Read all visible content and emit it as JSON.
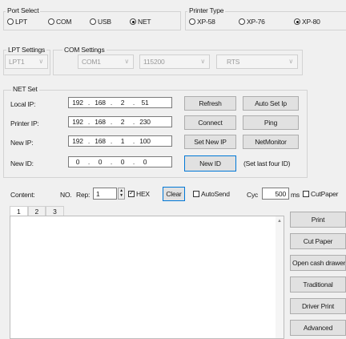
{
  "port_select": {
    "legend": "Port Select",
    "options": [
      {
        "label": "LPT",
        "selected": false
      },
      {
        "label": "COM",
        "selected": false
      },
      {
        "label": "USB",
        "selected": false
      },
      {
        "label": "NET",
        "selected": true
      }
    ]
  },
  "printer_type": {
    "legend": "Printer Type",
    "options": [
      {
        "label": "XP-58",
        "selected": false
      },
      {
        "label": "XP-76",
        "selected": false
      },
      {
        "label": "XP-80",
        "selected": true
      }
    ]
  },
  "lpt_settings": {
    "legend": "LPT Settings",
    "port": "LPT1"
  },
  "com_settings": {
    "legend": "COM Settings",
    "port": "COM1",
    "baud": "115200",
    "flow": "RTS"
  },
  "net_set": {
    "legend": "NET Set",
    "rows": [
      {
        "label": "Local IP:",
        "ip": [
          "192",
          "168",
          "2",
          "51"
        ],
        "btn1": "Refresh",
        "btn2": "Auto Set Ip"
      },
      {
        "label": "Printer IP:",
        "ip": [
          "192",
          "168",
          "2",
          "230"
        ],
        "btn1": "Connect",
        "btn2": "Ping"
      },
      {
        "label": "New IP:",
        "ip": [
          "192",
          "168",
          "1",
          "100"
        ],
        "btn1": "Set New IP",
        "btn2": "NetMonitor"
      },
      {
        "label": "New ID:",
        "ip": [
          "0",
          "0",
          "0",
          "0"
        ],
        "btn1": "New ID",
        "note": "(Set last four ID)"
      }
    ]
  },
  "content_bar": {
    "content_label": "Content:",
    "no_label": "NO.",
    "rep_label": "Rep:",
    "rep_value": "1",
    "hex_label": "HEX",
    "hex_checked": true,
    "clear_label": "Clear",
    "autosend_label": "AutoSend",
    "autosend_checked": false,
    "cyc_label": "Cyc",
    "cyc_value": "500",
    "ms_label": "ms",
    "cutpaper_label": "CutPaper",
    "cutpaper_checked": false
  },
  "tabs": [
    "1",
    "2",
    "3"
  ],
  "side_buttons": [
    "Print",
    "Cut Paper",
    "Open cash drawer",
    "Traditional",
    "Driver Print",
    "Advanced"
  ]
}
